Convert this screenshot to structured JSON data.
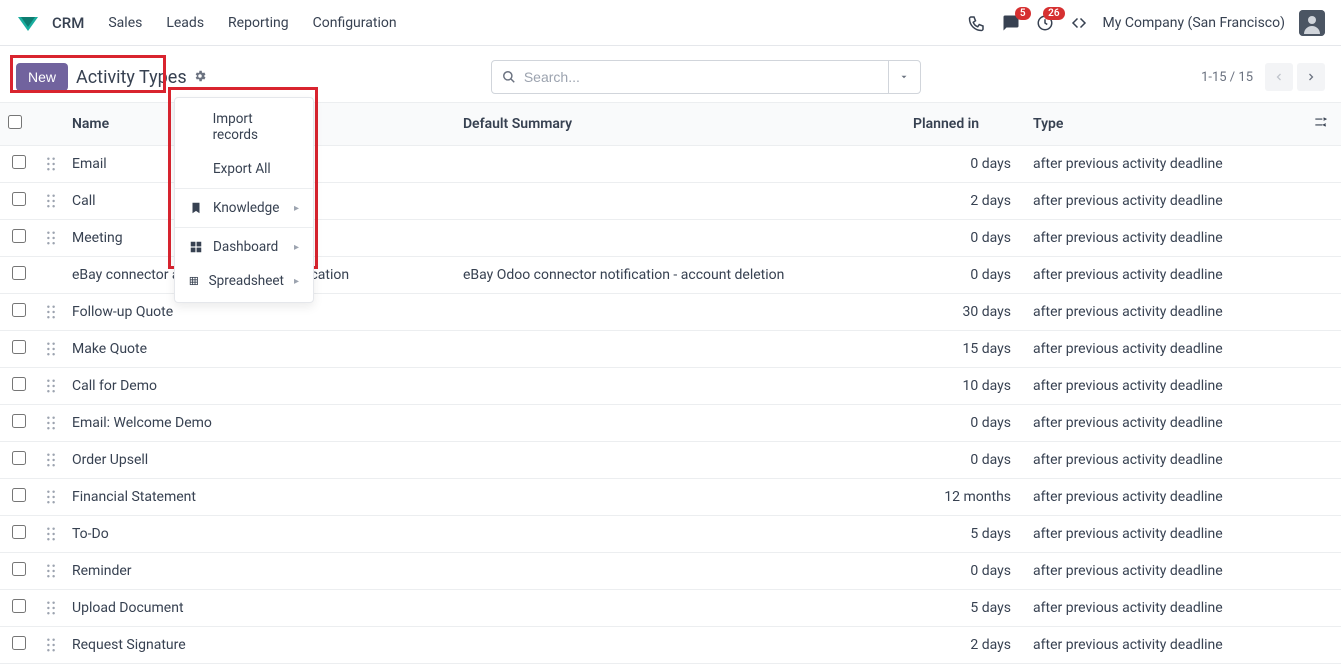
{
  "navbar": {
    "app": "CRM",
    "links": [
      "Sales",
      "Leads",
      "Reporting",
      "Configuration"
    ],
    "messages_badge": "5",
    "activities_badge": "26",
    "company": "My Company (San Francisco)"
  },
  "control_panel": {
    "new_label": "New",
    "title": "Activity Types",
    "search_placeholder": "Search...",
    "pager": "1-15 / 15"
  },
  "gear_menu": {
    "import": "Import records",
    "export": "Export All",
    "knowledge": "Knowledge",
    "dashboard": "Dashboard",
    "spreadsheet": "Spreadsheet"
  },
  "columns": {
    "name": "Name",
    "summary": "Default Summary",
    "planned": "Planned in",
    "type": "Type"
  },
  "rows": [
    {
      "name": "Email",
      "summary": "",
      "planned": "0 days",
      "type": "after previous activity deadline",
      "handle": true
    },
    {
      "name": "Call",
      "summary": "",
      "planned": "2 days",
      "type": "after previous activity deadline",
      "handle": true
    },
    {
      "name": "Meeting",
      "summary": "",
      "planned": "0 days",
      "type": "after previous activity deadline",
      "handle": true
    },
    {
      "name": "eBay connector account deletion notification",
      "summary": "eBay Odoo connector notification - account deletion",
      "planned": "0 days",
      "type": "after previous activity deadline",
      "handle": false
    },
    {
      "name": "Follow-up Quote",
      "summary": "",
      "planned": "30 days",
      "type": "after previous activity deadline",
      "handle": true
    },
    {
      "name": "Make Quote",
      "summary": "",
      "planned": "15 days",
      "type": "after previous activity deadline",
      "handle": true
    },
    {
      "name": "Call for Demo",
      "summary": "",
      "planned": "10 days",
      "type": "after previous activity deadline",
      "handle": true
    },
    {
      "name": "Email: Welcome Demo",
      "summary": "",
      "planned": "0 days",
      "type": "after previous activity deadline",
      "handle": true
    },
    {
      "name": "Order Upsell",
      "summary": "",
      "planned": "0 days",
      "type": "after previous activity deadline",
      "handle": true
    },
    {
      "name": "Financial Statement",
      "summary": "",
      "planned": "12 months",
      "type": "after previous activity deadline",
      "handle": true
    },
    {
      "name": "To-Do",
      "summary": "",
      "planned": "5 days",
      "type": "after previous activity deadline",
      "handle": true
    },
    {
      "name": "Reminder",
      "summary": "",
      "planned": "0 days",
      "type": "after previous activity deadline",
      "handle": true
    },
    {
      "name": "Upload Document",
      "summary": "",
      "planned": "5 days",
      "type": "after previous activity deadline",
      "handle": true
    },
    {
      "name": "Request Signature",
      "summary": "",
      "planned": "2 days",
      "type": "after previous activity deadline",
      "handle": true
    }
  ]
}
